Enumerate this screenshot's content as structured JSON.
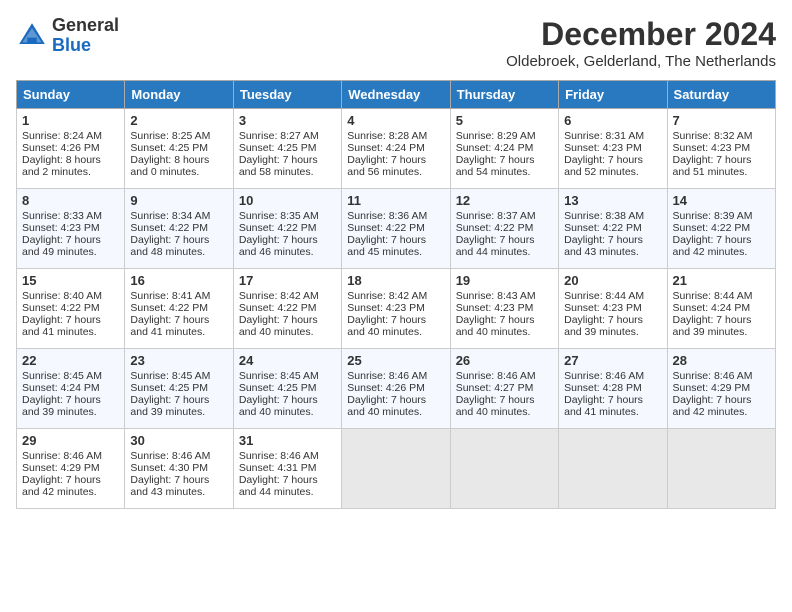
{
  "header": {
    "logo_general": "General",
    "logo_blue": "Blue",
    "month": "December 2024",
    "location": "Oldebroek, Gelderland, The Netherlands"
  },
  "columns": [
    "Sunday",
    "Monday",
    "Tuesday",
    "Wednesday",
    "Thursday",
    "Friday",
    "Saturday"
  ],
  "weeks": [
    [
      {
        "day": "1",
        "lines": [
          "Sunrise: 8:24 AM",
          "Sunset: 4:26 PM",
          "Daylight: 8 hours",
          "and 2 minutes."
        ]
      },
      {
        "day": "2",
        "lines": [
          "Sunrise: 8:25 AM",
          "Sunset: 4:25 PM",
          "Daylight: 8 hours",
          "and 0 minutes."
        ]
      },
      {
        "day": "3",
        "lines": [
          "Sunrise: 8:27 AM",
          "Sunset: 4:25 PM",
          "Daylight: 7 hours",
          "and 58 minutes."
        ]
      },
      {
        "day": "4",
        "lines": [
          "Sunrise: 8:28 AM",
          "Sunset: 4:24 PM",
          "Daylight: 7 hours",
          "and 56 minutes."
        ]
      },
      {
        "day": "5",
        "lines": [
          "Sunrise: 8:29 AM",
          "Sunset: 4:24 PM",
          "Daylight: 7 hours",
          "and 54 minutes."
        ]
      },
      {
        "day": "6",
        "lines": [
          "Sunrise: 8:31 AM",
          "Sunset: 4:23 PM",
          "Daylight: 7 hours",
          "and 52 minutes."
        ]
      },
      {
        "day": "7",
        "lines": [
          "Sunrise: 8:32 AM",
          "Sunset: 4:23 PM",
          "Daylight: 7 hours",
          "and 51 minutes."
        ]
      }
    ],
    [
      {
        "day": "8",
        "lines": [
          "Sunrise: 8:33 AM",
          "Sunset: 4:23 PM",
          "Daylight: 7 hours",
          "and 49 minutes."
        ]
      },
      {
        "day": "9",
        "lines": [
          "Sunrise: 8:34 AM",
          "Sunset: 4:22 PM",
          "Daylight: 7 hours",
          "and 48 minutes."
        ]
      },
      {
        "day": "10",
        "lines": [
          "Sunrise: 8:35 AM",
          "Sunset: 4:22 PM",
          "Daylight: 7 hours",
          "and 46 minutes."
        ]
      },
      {
        "day": "11",
        "lines": [
          "Sunrise: 8:36 AM",
          "Sunset: 4:22 PM",
          "Daylight: 7 hours",
          "and 45 minutes."
        ]
      },
      {
        "day": "12",
        "lines": [
          "Sunrise: 8:37 AM",
          "Sunset: 4:22 PM",
          "Daylight: 7 hours",
          "and 44 minutes."
        ]
      },
      {
        "day": "13",
        "lines": [
          "Sunrise: 8:38 AM",
          "Sunset: 4:22 PM",
          "Daylight: 7 hours",
          "and 43 minutes."
        ]
      },
      {
        "day": "14",
        "lines": [
          "Sunrise: 8:39 AM",
          "Sunset: 4:22 PM",
          "Daylight: 7 hours",
          "and 42 minutes."
        ]
      }
    ],
    [
      {
        "day": "15",
        "lines": [
          "Sunrise: 8:40 AM",
          "Sunset: 4:22 PM",
          "Daylight: 7 hours",
          "and 41 minutes."
        ]
      },
      {
        "day": "16",
        "lines": [
          "Sunrise: 8:41 AM",
          "Sunset: 4:22 PM",
          "Daylight: 7 hours",
          "and 41 minutes."
        ]
      },
      {
        "day": "17",
        "lines": [
          "Sunrise: 8:42 AM",
          "Sunset: 4:22 PM",
          "Daylight: 7 hours",
          "and 40 minutes."
        ]
      },
      {
        "day": "18",
        "lines": [
          "Sunrise: 8:42 AM",
          "Sunset: 4:23 PM",
          "Daylight: 7 hours",
          "and 40 minutes."
        ]
      },
      {
        "day": "19",
        "lines": [
          "Sunrise: 8:43 AM",
          "Sunset: 4:23 PM",
          "Daylight: 7 hours",
          "and 40 minutes."
        ]
      },
      {
        "day": "20",
        "lines": [
          "Sunrise: 8:44 AM",
          "Sunset: 4:23 PM",
          "Daylight: 7 hours",
          "and 39 minutes."
        ]
      },
      {
        "day": "21",
        "lines": [
          "Sunrise: 8:44 AM",
          "Sunset: 4:24 PM",
          "Daylight: 7 hours",
          "and 39 minutes."
        ]
      }
    ],
    [
      {
        "day": "22",
        "lines": [
          "Sunrise: 8:45 AM",
          "Sunset: 4:24 PM",
          "Daylight: 7 hours",
          "and 39 minutes."
        ]
      },
      {
        "day": "23",
        "lines": [
          "Sunrise: 8:45 AM",
          "Sunset: 4:25 PM",
          "Daylight: 7 hours",
          "and 39 minutes."
        ]
      },
      {
        "day": "24",
        "lines": [
          "Sunrise: 8:45 AM",
          "Sunset: 4:25 PM",
          "Daylight: 7 hours",
          "and 40 minutes."
        ]
      },
      {
        "day": "25",
        "lines": [
          "Sunrise: 8:46 AM",
          "Sunset: 4:26 PM",
          "Daylight: 7 hours",
          "and 40 minutes."
        ]
      },
      {
        "day": "26",
        "lines": [
          "Sunrise: 8:46 AM",
          "Sunset: 4:27 PM",
          "Daylight: 7 hours",
          "and 40 minutes."
        ]
      },
      {
        "day": "27",
        "lines": [
          "Sunrise: 8:46 AM",
          "Sunset: 4:28 PM",
          "Daylight: 7 hours",
          "and 41 minutes."
        ]
      },
      {
        "day": "28",
        "lines": [
          "Sunrise: 8:46 AM",
          "Sunset: 4:29 PM",
          "Daylight: 7 hours",
          "and 42 minutes."
        ]
      }
    ],
    [
      {
        "day": "29",
        "lines": [
          "Sunrise: 8:46 AM",
          "Sunset: 4:29 PM",
          "Daylight: 7 hours",
          "and 42 minutes."
        ]
      },
      {
        "day": "30",
        "lines": [
          "Sunrise: 8:46 AM",
          "Sunset: 4:30 PM",
          "Daylight: 7 hours",
          "and 43 minutes."
        ]
      },
      {
        "day": "31",
        "lines": [
          "Sunrise: 8:46 AM",
          "Sunset: 4:31 PM",
          "Daylight: 7 hours",
          "and 44 minutes."
        ]
      },
      null,
      null,
      null,
      null
    ]
  ]
}
